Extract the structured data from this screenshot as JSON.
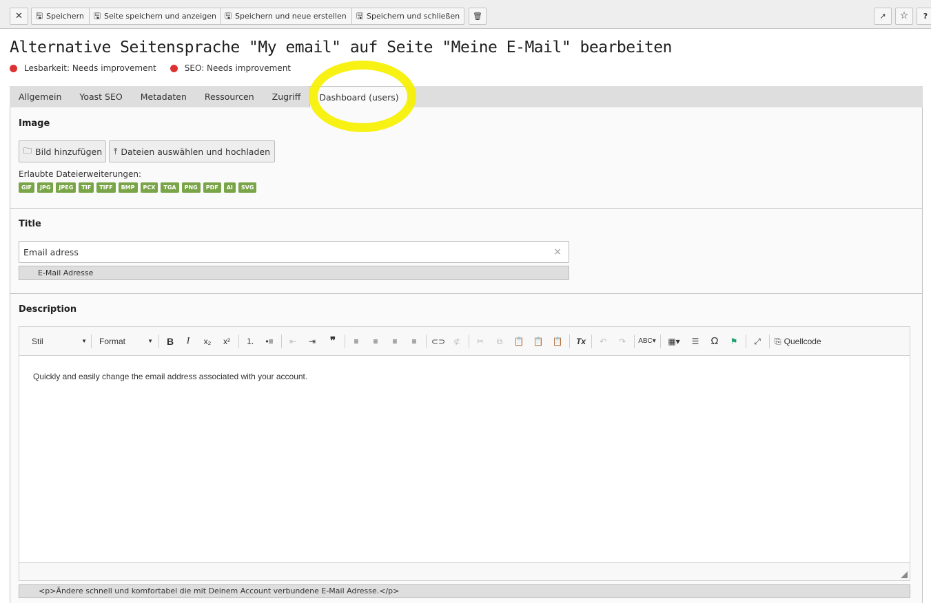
{
  "toolbar": {
    "close_icon": "close-icon",
    "save": "Speichern",
    "save_view": "Seite speichern und anzeigen",
    "save_new": "Speichern und neue erstellen",
    "save_close": "Speichern und schließen",
    "help": "?"
  },
  "page": {
    "title": "Alternative Seitensprache \"My email\" auf Seite \"Meine E-Mail\" bearbeiten",
    "readability": "Lesbarkeit: Needs improvement",
    "seo": "SEO: Needs improvement",
    "status_color": "#dc3232"
  },
  "tabs": [
    {
      "label": "Allgemein"
    },
    {
      "label": "Yoast SEO"
    },
    {
      "label": "Metadaten"
    },
    {
      "label": "Ressourcen"
    },
    {
      "label": "Zugriff"
    },
    {
      "label": "Dashboard (users)",
      "active": true
    }
  ],
  "image_section": {
    "title": "Image",
    "add_button": "Bild hinzufügen",
    "upload_button": "Dateien auswählen und hochladen",
    "extensions_label": "Erlaubte Dateierweiterungen:",
    "extensions": [
      "GIF",
      "JPG",
      "JPEG",
      "TIF",
      "TIFF",
      "BMP",
      "PCX",
      "TGA",
      "PNG",
      "PDF",
      "AI",
      "SVG"
    ],
    "badge_color": "#79a548"
  },
  "title_section": {
    "title": "Title",
    "value": "Email adress",
    "default_value": "E-Mail Adresse"
  },
  "description_section": {
    "title": "Description",
    "style_dropdown": "Stil",
    "format_dropdown": "Format",
    "source_button": "Quellcode",
    "content": "Quickly and easily change the email address associated with your account.",
    "default_source": "<p>Ändere schnell und komfortabel die mit Deinem Account verbundene E-Mail Adresse.</p>"
  },
  "annotation_color": "#f7f000"
}
